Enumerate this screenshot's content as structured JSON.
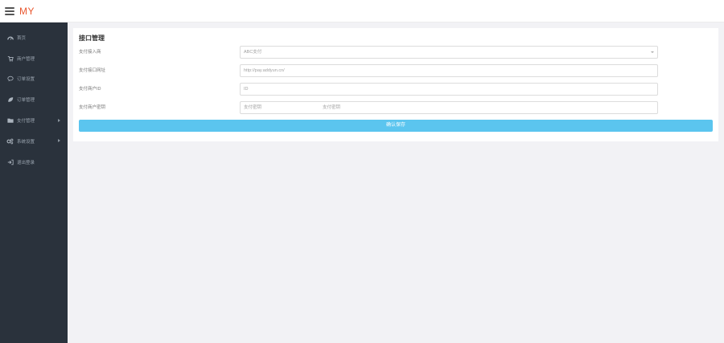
{
  "header": {
    "logo_text": "MY"
  },
  "sidebar": {
    "items": [
      {
        "label": "首页",
        "icon": "dashboard-icon"
      },
      {
        "label": "商户管理",
        "icon": "cart-icon"
      },
      {
        "label": "订单设置",
        "icon": "chat-icon"
      },
      {
        "label": "订单管理",
        "icon": "leaf-icon"
      },
      {
        "label": "支付管理",
        "icon": "folder-icon",
        "has_submenu": true
      },
      {
        "label": "系统设置",
        "icon": "cogs-icon",
        "has_submenu": true
      },
      {
        "label": "退出登录",
        "icon": "logout-icon"
      }
    ]
  },
  "form": {
    "title": "接口管理",
    "fields": [
      {
        "label": "支付接入商",
        "value": "ABC支付",
        "type": "select"
      },
      {
        "label": "支付接口网址",
        "value": "http://pay.addyun.cn/",
        "type": "input"
      },
      {
        "label": "支付商户ID",
        "value": "ID",
        "type": "input"
      },
      {
        "label": "支付商户密钥",
        "value_left": "支付密钥",
        "value_right": "支付密钥",
        "type": "split"
      }
    ],
    "submit_label": "确认保存"
  },
  "colors": {
    "sidebar_bg": "#2a323c",
    "accent_button": "#5bc5ef",
    "logo": "#e9572f"
  }
}
